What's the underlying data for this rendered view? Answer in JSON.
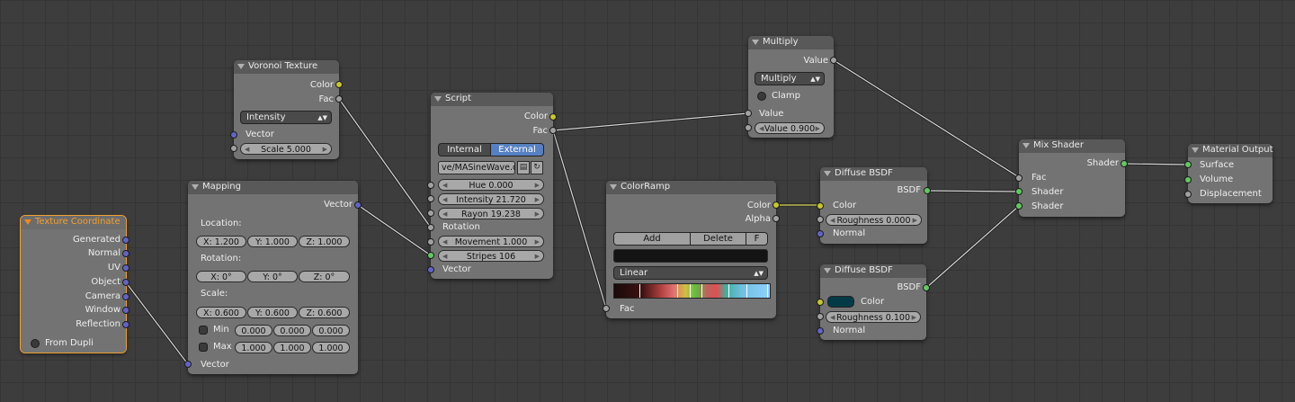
{
  "colors": {
    "socket_color": "#c7c729",
    "socket_float": "#a1a1a1",
    "socket_vector": "#6363c7",
    "socket_shader": "#63c763",
    "selected": "#f0a030",
    "active_button": "#5680c2",
    "diffuse2_color": "#003b45"
  },
  "nodes": {
    "texcoord": {
      "title": "Texture Coordinate",
      "outputs": [
        "Generated",
        "Normal",
        "UV",
        "Object",
        "Camera",
        "Window",
        "Reflection"
      ],
      "from_dupli": "From Dupli"
    },
    "voronoi": {
      "title": "Voronoi Texture",
      "out_color": "Color",
      "out_fac": "Fac",
      "mode": "Intensity",
      "in_vector": "Vector",
      "scale": "Scale 5.000"
    },
    "mapping": {
      "title": "Mapping",
      "out_vector": "Vector",
      "location_label": "Location:",
      "location": [
        "X: 1.200",
        "Y: 1.000",
        "Z: 1.000"
      ],
      "rotation_label": "Rotation:",
      "rotation": [
        "X: 0°",
        "Y: 0°",
        "Z: 0°"
      ],
      "scale_label": "Scale:",
      "scale": [
        "X: 0.600",
        "Y: 0.600",
        "Z: 0.600"
      ],
      "min_label": "Min",
      "min": [
        "0.000",
        "0.000",
        "0.000"
      ],
      "max_label": "Max",
      "max": [
        "1.000",
        "1.000",
        "1.000"
      ],
      "in_vector": "Vector"
    },
    "script": {
      "title": "Script",
      "out_color": "Color",
      "out_fac": "Fac",
      "mode_internal": "Internal",
      "mode_external": "External",
      "file": "ve/MASineWave.osl",
      "hue": "Hue 0.000",
      "intensity": "Intensity 21.720",
      "rayon": "Rayon 19.238",
      "rotation": "Rotation",
      "movement": "Movement 1.000",
      "stripes": "Stripes 106",
      "in_vector": "Vector"
    },
    "multiply": {
      "title": "Multiply",
      "out_value": "Value",
      "operation": "Multiply",
      "clamp": "Clamp",
      "in_value": "Value",
      "value": "Value 0.900"
    },
    "colorramp": {
      "title": "ColorRamp",
      "out_color": "Color",
      "out_alpha": "Alpha",
      "add": "Add",
      "delete": "Delete",
      "flip": "F",
      "interp": "Linear",
      "in_fac": "Fac"
    },
    "diffuse1": {
      "title": "Diffuse BSDF",
      "out_bsdf": "BSDF",
      "in_color": "Color",
      "roughness": "Roughness 0.000",
      "in_normal": "Normal"
    },
    "diffuse2": {
      "title": "Diffuse BSDF",
      "out_bsdf": "BSDF",
      "in_color": "Color",
      "roughness": "Roughness 0.100",
      "in_normal": "Normal"
    },
    "mix": {
      "title": "Mix Shader",
      "out_shader": "Shader",
      "in_fac": "Fac",
      "in_shader1": "Shader",
      "in_shader2": "Shader"
    },
    "output": {
      "title": "Material Output",
      "in_surface": "Surface",
      "in_volume": "Volume",
      "in_displacement": "Displacement"
    }
  }
}
